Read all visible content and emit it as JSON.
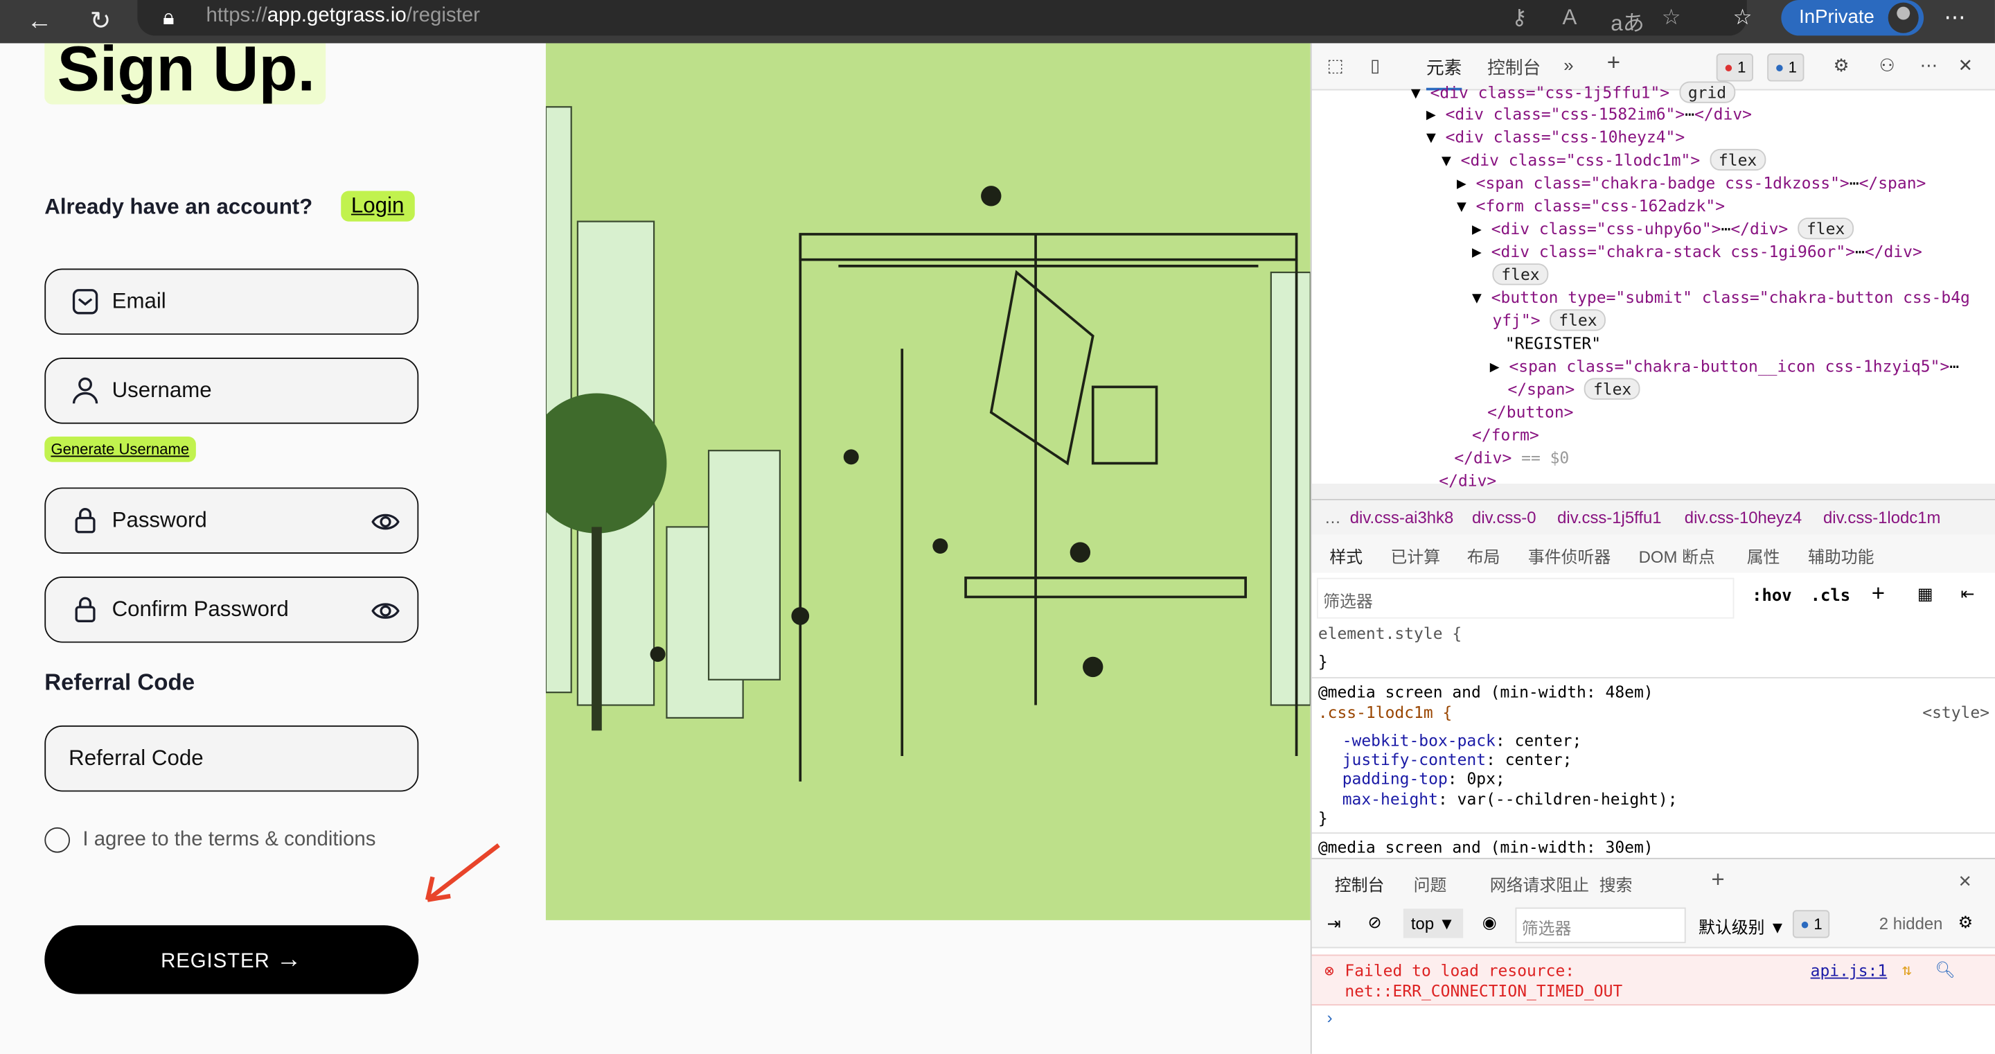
{
  "browser": {
    "url_prefix": "https://",
    "url_host": "app.getgrass.io",
    "url_path": "/register",
    "inprivate_label": "InPrivate"
  },
  "page": {
    "title": "Sign Up.",
    "already_text": "Already have an account?",
    "login_label": "Login",
    "fields": {
      "email": "Email",
      "username": "Username",
      "password": "Password",
      "confirm_password": "Confirm Password",
      "referral": "Referral Code"
    },
    "generate_username": "Generate Username",
    "referral_heading": "Referral Code",
    "terms": "I agree to the terms & conditions",
    "register": "REGISTER",
    "accent": "#c1f24e",
    "art_bg": "#bde08a"
  },
  "devtools": {
    "tabs": [
      "元素",
      "控制台"
    ],
    "error_count": "1",
    "info_count": "1",
    "tree": {
      "l0": [
        "<div class=\"css-1j5ffu1\">",
        "grid"
      ],
      "l1": "<div class=\"css-1582im6\">",
      "l1b": "</div>",
      "l2": "<div class=\"css-10heyz4\">",
      "l3": [
        "<div class=\"css-1lodc1m\">",
        "flex"
      ],
      "l4": "<span class=\"chakra-badge css-1dkzoss\">",
      "l4b": "</span>",
      "l5": "<form class=\"css-162adzk\">",
      "l6": [
        "<div class=\"css-uhpy6o\">",
        "</div>",
        "flex"
      ],
      "l7": [
        "<div class=\"chakra-stack css-1gi96or\">",
        "</div>",
        "flex"
      ],
      "l8": [
        "<button type=\"submit\" class=\"chakra-button css-b4g",
        "yfj\">",
        "flex"
      ],
      "l9": "\"REGISTER\"",
      "l10": [
        "<span class=\"chakra-button__icon css-1hzyiq5\">",
        "</span>",
        "flex"
      ],
      "l11": "</button>",
      "l12": "</form>",
      "l13": "</div>",
      "l13b": "== $0",
      "l14": "</div>"
    },
    "breadcrumbs": [
      "div.css-ai3hk8",
      "div.css-0",
      "div.css-1j5ffu1",
      "div.css-10heyz4",
      "div.css-1lodc1m"
    ],
    "style_tabs": [
      "样式",
      "已计算",
      "布局",
      "事件侦听器",
      "DOM 断点",
      "属性",
      "辅助功能"
    ],
    "filter_placeholder": "筛选器",
    "hov": ":hov",
    "cls": ".cls",
    "css": {
      "element_style": "element.style {",
      "close": "}",
      "media1": "@media screen and (min-width: 48em)",
      "selector": ".css-1lodc1m {",
      "source": "<style>",
      "props": [
        [
          "-webkit-box-pack",
          "center;"
        ],
        [
          "justify-content",
          "center;"
        ],
        [
          "padding-top",
          "0px;"
        ],
        [
          "max-height",
          "var(--children-height);"
        ]
      ],
      "media2": "@media screen and (min-width: 30em)"
    },
    "console_tabs": [
      "控制台",
      "问题",
      "网络请求阻止",
      "搜索"
    ],
    "console": {
      "context": "top",
      "filter_placeholder": "筛选器",
      "level": "默认级别",
      "msg_count": "1",
      "hidden": "2 hidden",
      "error_line1": "Failed to load resource:",
      "error_line2": "net::ERR_CONNECTION_TIMED_OUT",
      "error_source": "api.js:1"
    }
  }
}
